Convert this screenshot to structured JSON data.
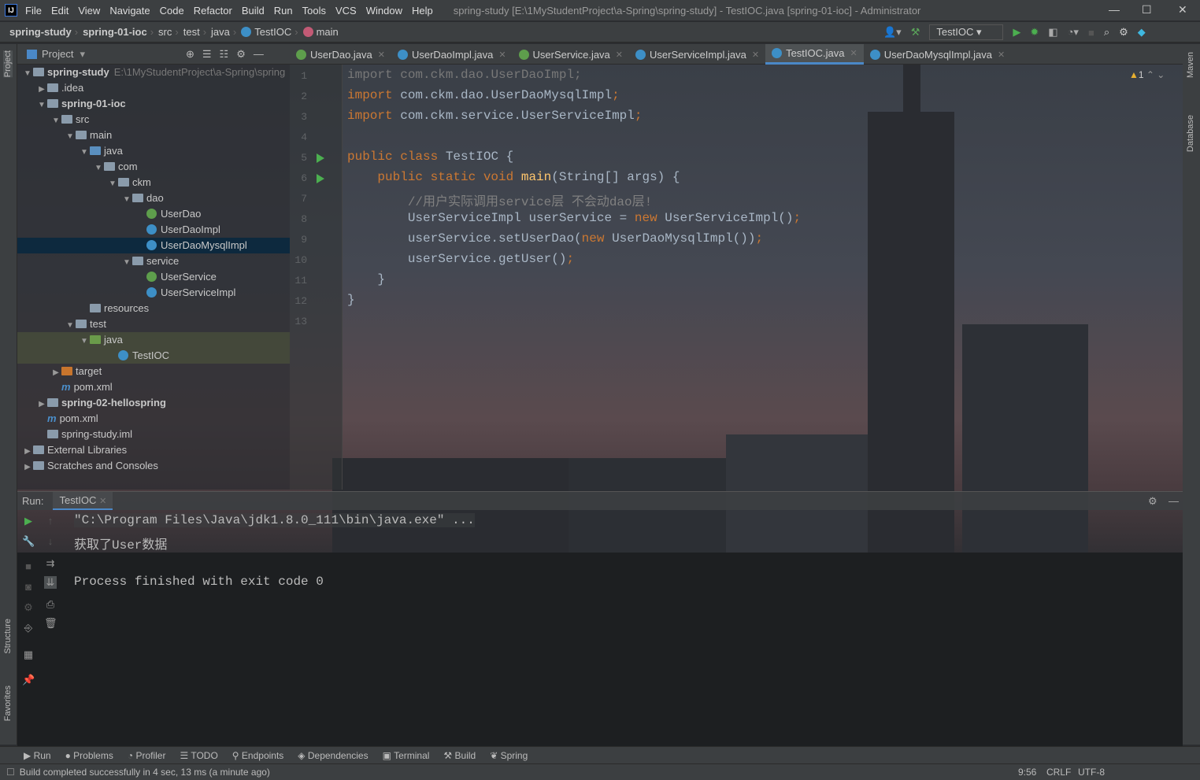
{
  "window": {
    "title": "spring-study [E:\\1MyStudentProject\\a-Spring\\spring-study] - TestIOC.java [spring-01-ioc] - Administrator",
    "logo": "IJ"
  },
  "menu": [
    "File",
    "Edit",
    "View",
    "Navigate",
    "Code",
    "Refactor",
    "Build",
    "Run",
    "Tools",
    "VCS",
    "Window",
    "Help"
  ],
  "breadcrumb": [
    "spring-study",
    "spring-01-ioc",
    "src",
    "test",
    "java",
    "TestIOC",
    "main"
  ],
  "toolbar": {
    "run_config": "TestIOC"
  },
  "side_left": [
    "Project",
    "Structure",
    "Favorites"
  ],
  "side_right": [
    "Maven",
    "Database"
  ],
  "project": {
    "title": "Project",
    "tree": [
      {
        "label": "spring-study",
        "depth": 0,
        "arrow": "down",
        "icon": "folder",
        "bold": true,
        "path": "E:\\1MyStudentProject\\a-Spring\\spring"
      },
      {
        "label": ".idea",
        "depth": 1,
        "arrow": "right",
        "icon": "folder"
      },
      {
        "label": "spring-01-ioc",
        "depth": 1,
        "arrow": "down",
        "icon": "folder",
        "bold": true
      },
      {
        "label": "src",
        "depth": 2,
        "arrow": "down",
        "icon": "folder"
      },
      {
        "label": "main",
        "depth": 3,
        "arrow": "down",
        "icon": "folder"
      },
      {
        "label": "java",
        "depth": 4,
        "arrow": "down",
        "icon": "src"
      },
      {
        "label": "com",
        "depth": 5,
        "arrow": "down",
        "icon": "folder"
      },
      {
        "label": "ckm",
        "depth": 6,
        "arrow": "down",
        "icon": "folder"
      },
      {
        "label": "dao",
        "depth": 7,
        "arrow": "down",
        "icon": "folder"
      },
      {
        "label": "UserDao",
        "depth": 8,
        "icon": "interface"
      },
      {
        "label": "UserDaoImpl",
        "depth": 8,
        "icon": "class"
      },
      {
        "label": "UserDaoMysqlImpl",
        "depth": 8,
        "icon": "class",
        "selected": true
      },
      {
        "label": "service",
        "depth": 7,
        "arrow": "down",
        "icon": "folder"
      },
      {
        "label": "UserService",
        "depth": 8,
        "icon": "interface"
      },
      {
        "label": "UserServiceImpl",
        "depth": 8,
        "icon": "class"
      },
      {
        "label": "resources",
        "depth": 4,
        "icon": "folder"
      },
      {
        "label": "test",
        "depth": 3,
        "arrow": "down",
        "icon": "folder"
      },
      {
        "label": "java",
        "depth": 4,
        "arrow": "down",
        "icon": "test",
        "highlight": true
      },
      {
        "label": "TestIOC",
        "depth": 6,
        "icon": "class",
        "highlight": true
      },
      {
        "label": "target",
        "depth": 2,
        "arrow": "right",
        "icon": "target"
      },
      {
        "label": "pom.xml",
        "depth": 2,
        "icon": "maven"
      },
      {
        "label": "spring-02-hellospring",
        "depth": 1,
        "arrow": "right",
        "icon": "folder",
        "bold": true
      },
      {
        "label": "pom.xml",
        "depth": 1,
        "icon": "maven"
      },
      {
        "label": "spring-study.iml",
        "depth": 1,
        "icon": "file"
      },
      {
        "label": "External Libraries",
        "depth": 0,
        "arrow": "right",
        "icon": "lib"
      },
      {
        "label": "Scratches and Consoles",
        "depth": 0,
        "arrow": "right",
        "icon": "scratch"
      }
    ]
  },
  "tabs": [
    {
      "label": "UserDao.java",
      "icon": "interface"
    },
    {
      "label": "UserDaoImpl.java",
      "icon": "class"
    },
    {
      "label": "UserService.java",
      "icon": "interface"
    },
    {
      "label": "UserServiceImpl.java",
      "icon": "class"
    },
    {
      "label": "TestIOC.java",
      "icon": "class",
      "active": true
    },
    {
      "label": "UserDaoMysqlImpl.java",
      "icon": "class"
    }
  ],
  "editor": {
    "warnings": "1",
    "lines": [
      [
        [
          "import ",
          "gr"
        ],
        [
          "com.ckm.dao.UserDaoImpl;",
          "gr"
        ]
      ],
      [
        [
          "import ",
          "kw"
        ],
        [
          "com.ckm.dao.UserDaoMysqlImpl",
          "pl"
        ],
        [
          ";",
          "kw"
        ]
      ],
      [
        [
          "import ",
          "kw"
        ],
        [
          "com.ckm.service.UserServiceImpl",
          "pl"
        ],
        [
          ";",
          "kw"
        ]
      ],
      [],
      [
        [
          "public class ",
          "kw"
        ],
        [
          "TestIOC {",
          "pl"
        ]
      ],
      [
        [
          "    public static void ",
          "kw"
        ],
        [
          "main",
          "fn"
        ],
        [
          "(String[] args) {",
          "pl"
        ]
      ],
      [
        [
          "        //用户实际调用service层 不会动dao层!",
          "cm"
        ]
      ],
      [
        [
          "        UserServiceImpl userService = ",
          "pl"
        ],
        [
          "new ",
          "kw"
        ],
        [
          "UserServiceImpl()",
          "pl"
        ],
        [
          ";",
          "kw"
        ]
      ],
      [
        [
          "        userService.setUserDao(",
          "pl"
        ],
        [
          "new ",
          "kw"
        ],
        [
          "UserDaoMysqlImpl())",
          "pl"
        ],
        [
          ";",
          "kw"
        ]
      ],
      [
        [
          "        userService.getUser()",
          "pl"
        ],
        [
          ";",
          "kw"
        ]
      ],
      [
        [
          "    }",
          "pl"
        ]
      ],
      [
        [
          "}",
          "pl"
        ]
      ],
      []
    ]
  },
  "run": {
    "label": "Run:",
    "tab": "TestIOC",
    "console": [
      "\"C:\\Program Files\\Java\\jdk1.8.0_111\\bin\\java.exe\" ...",
      "获取了User数据",
      "",
      "Process finished with exit code 0"
    ]
  },
  "bottom_tabs": [
    "Run",
    "Problems",
    "Profiler",
    "TODO",
    "Endpoints",
    "Dependencies",
    "Terminal",
    "Build",
    "Spring"
  ],
  "status": {
    "message": "Build completed successfully in 4 sec, 13 ms (a minute ago)",
    "position": "9:56",
    "line_sep": "CRLF",
    "encoding": "UTF-8"
  },
  "colors": {
    "keyword": "#cc7832",
    "method": "#ffc66d",
    "comment": "#808080",
    "text": "#a9b7c6",
    "selection": "#0d293e"
  }
}
